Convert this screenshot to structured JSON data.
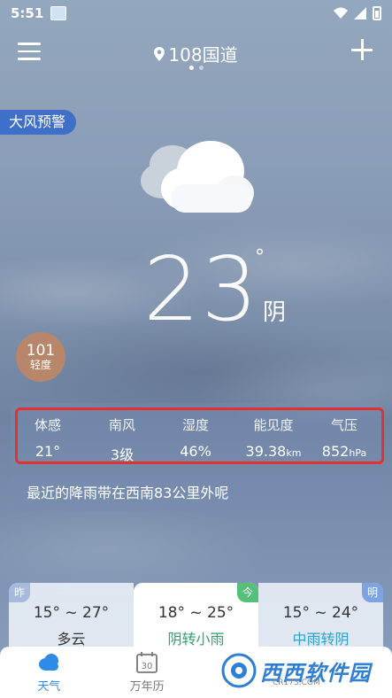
{
  "status_bar": {
    "time": "5:51"
  },
  "header": {
    "location": "108国道",
    "page_count": 2,
    "active_page": 0
  },
  "alert": {
    "label": "大风预警"
  },
  "current": {
    "icon": "cloudy-icon",
    "temperature": "23",
    "degree_symbol": "°",
    "condition": "阴"
  },
  "aqi": {
    "value": "101",
    "level": "轻度",
    "color": "#b8866a"
  },
  "details": [
    {
      "label": "体感",
      "value": "21°",
      "unit": ""
    },
    {
      "label": "南风",
      "value": "3级",
      "unit": ""
    },
    {
      "label": "湿度",
      "value": "46%",
      "unit": ""
    },
    {
      "label": "能见度",
      "value": "39.38",
      "unit": "km"
    },
    {
      "label": "气压",
      "value": "852",
      "unit": "hPa"
    }
  ],
  "notice": "最近的降雨带在西南83公里外呢",
  "forecast": [
    {
      "tag": "昨",
      "temp": "15° ~ 27°",
      "condition": "多云"
    },
    {
      "tag": "今",
      "temp": "18° ~ 25°",
      "condition": "阴转小雨"
    },
    {
      "tag": "明",
      "temp": "15° ~ 24°",
      "condition": "中雨转阴"
    }
  ],
  "bottom_nav": [
    {
      "label": "天气",
      "icon": "weather-icon",
      "active": true
    },
    {
      "label": "万年历",
      "icon": "calendar-icon",
      "calendar_day": "30",
      "active": false
    }
  ],
  "watermark": {
    "brand": "西西软件园",
    "url": "CR173.COM"
  },
  "colors": {
    "highlight_border": "#e0322e",
    "active_nav": "#2f8be8",
    "alert_bg": "#3f6fc8"
  }
}
